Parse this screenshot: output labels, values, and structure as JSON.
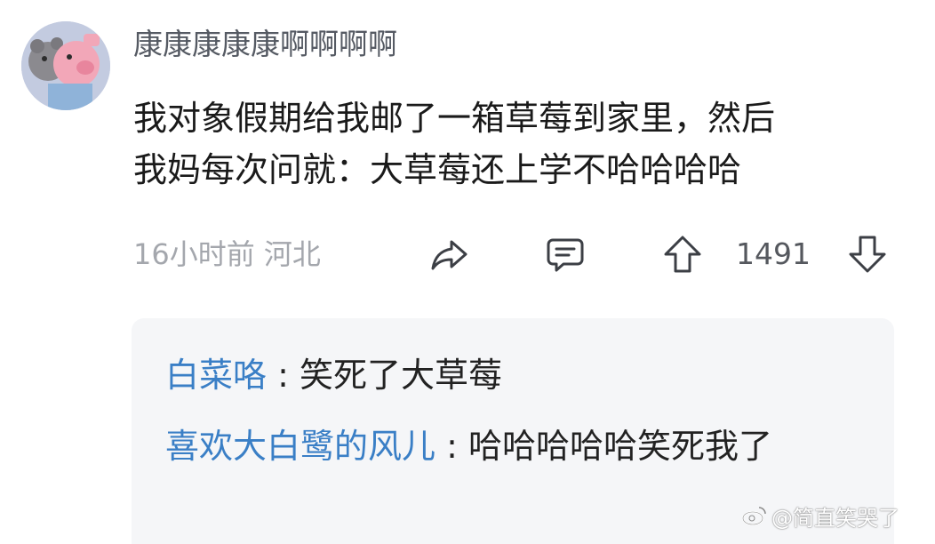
{
  "comment": {
    "username": "康康康康康啊啊啊啊",
    "text_lines": [
      "我对象假期给我邮了一箱草莓到家里，然后",
      "我妈每次问就：大草莓还上学不哈哈哈哈"
    ],
    "time": "16小时前",
    "location": "河北",
    "likes": "1491",
    "icons": [
      "share-icon",
      "comment-icon",
      "thumb-up-icon",
      "thumb-down-icon"
    ]
  },
  "replies": [
    {
      "name": "白菜咯",
      "separator": " : ",
      "text": "笑死了大草莓"
    },
    {
      "name": "喜欢大白鹭的风儿",
      "separator": " : ",
      "text": "哈哈哈哈哈笑死我了"
    }
  ],
  "watermark": {
    "text": "@简直笑哭了"
  },
  "colors": {
    "reply_name": "#3a7fc6",
    "meta": "#a4a7ad",
    "replies_bg": "#f5f6f8"
  }
}
